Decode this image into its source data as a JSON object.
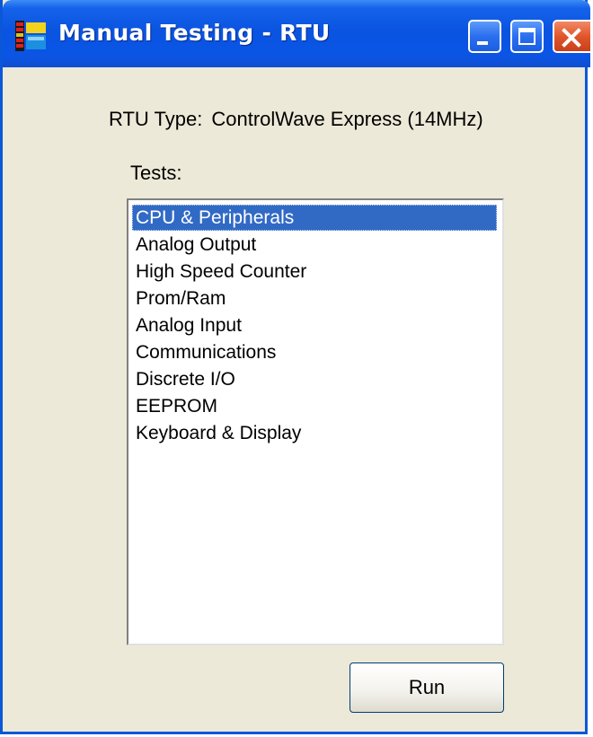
{
  "window": {
    "title": "Manual Testing - RTU",
    "app_icon": "rtu-app-icon",
    "controls": {
      "minimize_icon": "minimize-icon",
      "maximize_icon": "maximize-icon",
      "close_icon": "close-icon"
    }
  },
  "content": {
    "rtu_type_label": "RTU Type:",
    "rtu_type_value": "ControlWave Express (14MHz)",
    "tests_label": "Tests:",
    "tests": [
      "CPU & Peripherals",
      "Analog Output",
      "High Speed Counter",
      "Prom/Ram",
      "Analog Input",
      "Communications",
      "Discrete I/O",
      "EEPROM",
      "Keyboard & Display"
    ],
    "selected_test": "CPU & Peripherals",
    "run_label": "Run"
  },
  "colors": {
    "titlebar": "#0a54e1",
    "window_bg": "#ece9d8",
    "selection": "#316ac5",
    "close_button": "#e1552b"
  }
}
